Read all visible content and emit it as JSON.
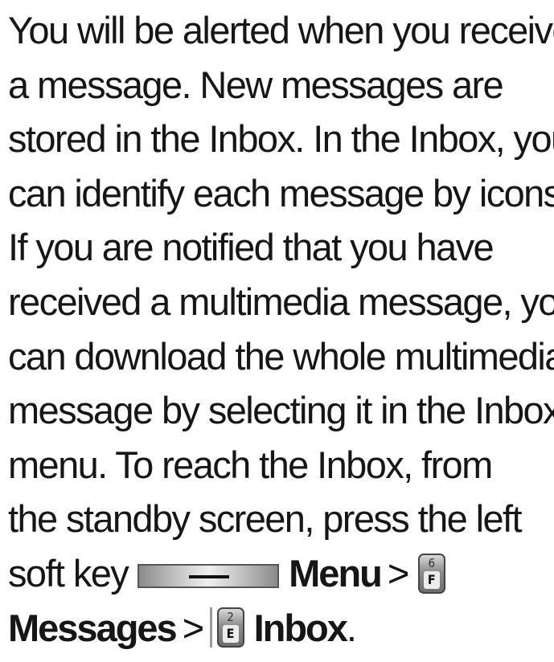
{
  "paragraph": {
    "lines": [
      "You will be alerted when you receive",
      "a message. New messages are",
      "stored in the Inbox. In the Inbox, you",
      "can identify each message by icons.",
      "If you are notified that you have",
      "received a multimedia message, you",
      "can download the whole multimedia",
      "message by selecting it in the Inbox",
      "menu. To reach the Inbox, from",
      "the standby screen, press the left"
    ],
    "line11_prefix": "soft key",
    "menu_label": "Menu",
    "sep1": ">",
    "key6": {
      "number": "6",
      "letter": "F"
    },
    "messages_label": "Messages",
    "sep2": ">",
    "key2": {
      "number": "2",
      "letter": "E"
    },
    "inbox_label": "Inbox",
    "period": "."
  },
  "icons": {
    "softkey": "soft-key-button-icon",
    "key6": "keypad-6-key-icon",
    "key2": "keypad-2-key-icon"
  }
}
